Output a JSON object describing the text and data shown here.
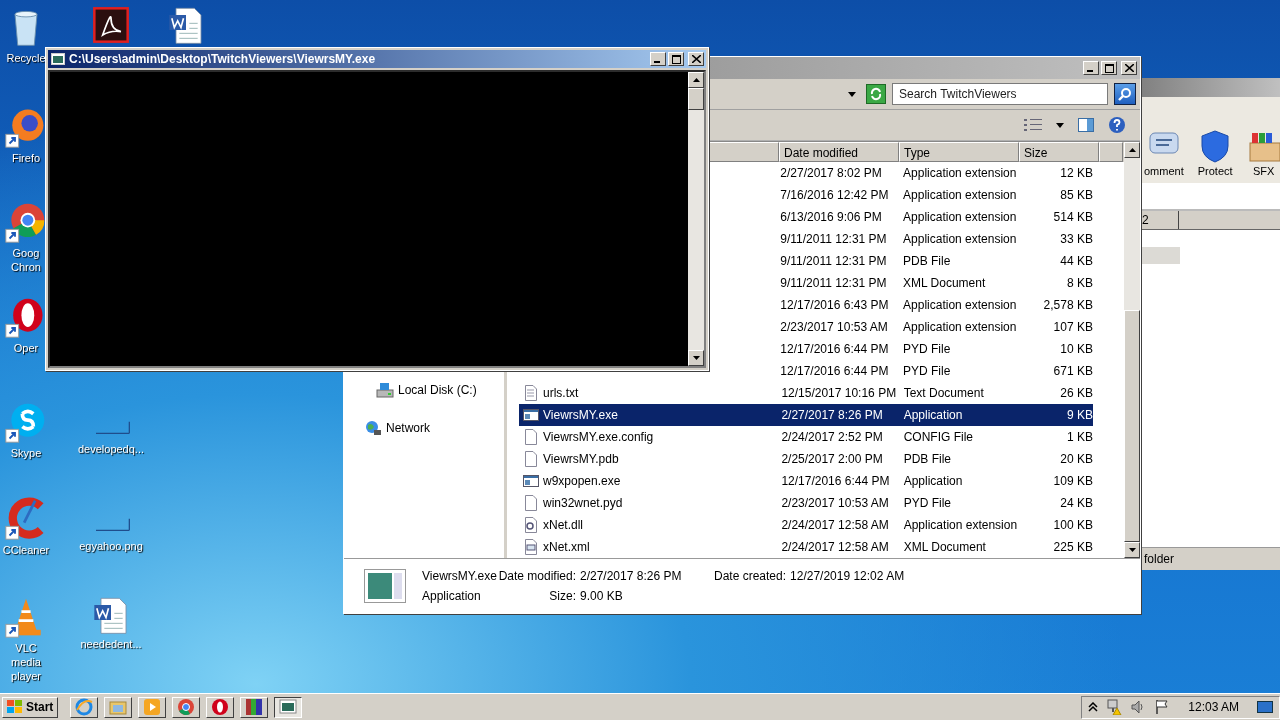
{
  "desktop": {
    "icons": [
      {
        "label": "Recycle",
        "kind": "recycle"
      },
      {
        "label": "Firefo",
        "kind": "firefox"
      },
      {
        "label": "Goog Chron",
        "kind": "chrome"
      },
      {
        "label": "Oper",
        "kind": "opera"
      },
      {
        "label": "Skype",
        "kind": "skype"
      },
      {
        "label": "CCleaner",
        "kind": "ccleaner"
      },
      {
        "label": "VLC media player",
        "kind": "vlc"
      },
      {
        "kind": "acrobat"
      },
      {
        "kind": "word"
      },
      {
        "label": "developedq...",
        "kind": "blank"
      },
      {
        "label": "egyahoo.png",
        "kind": "blank"
      },
      {
        "label": "neededent...",
        "kind": "word"
      }
    ]
  },
  "background_window": {
    "toolbar": [
      {
        "label": "omment",
        "kind": "comment"
      },
      {
        "label": "Protect",
        "kind": "protect"
      },
      {
        "label": "SFX",
        "kind": "sfx"
      }
    ],
    "column_1": "2",
    "status_text": "folder"
  },
  "explorer": {
    "search": {
      "placeholder": "Search TwitchViewers"
    },
    "columns": [
      "Date modified",
      "Type",
      "Size"
    ],
    "navigation": [
      {
        "label": "Local Disk (C:)",
        "kind": "disk"
      },
      {
        "label": "Network",
        "kind": "network"
      }
    ],
    "files": [
      {
        "date": "2/27/2017 8:02 PM",
        "type": "Application extension",
        "size": "12 KB",
        "selected": false
      },
      {
        "date": "7/16/2016 12:42 PM",
        "type": "Application extension",
        "size": "85 KB",
        "selected": false
      },
      {
        "date": "6/13/2016 9:06 PM",
        "type": "Application extension",
        "size": "514 KB",
        "selected": false
      },
      {
        "date": "9/11/2011 12:31 PM",
        "type": "Application extension",
        "size": "33 KB",
        "selected": false
      },
      {
        "date": "9/11/2011 12:31 PM",
        "type": "PDB File",
        "size": "44 KB",
        "selected": false
      },
      {
        "date": "9/11/2011 12:31 PM",
        "type": "XML Document",
        "size": "8 KB",
        "selected": false
      },
      {
        "date": "12/17/2016 6:43 PM",
        "type": "Application extension",
        "size": "2,578 KB",
        "selected": false
      },
      {
        "date": "2/23/2017 10:53 AM",
        "type": "Application extension",
        "size": "107 KB",
        "selected": false
      },
      {
        "date": "12/17/2016 6:44 PM",
        "type": "PYD File",
        "size": "10 KB",
        "selected": false
      },
      {
        "date": "12/17/2016 6:44 PM",
        "type": "PYD File",
        "size": "671 KB",
        "selected": false
      },
      {
        "name": "urls.txt",
        "kind": "text",
        "date": "12/15/2017 10:16 PM",
        "type": "Text Document",
        "size": "26 KB",
        "selected": false
      },
      {
        "name": "ViewrsMY.exe",
        "kind": "exe",
        "date": "2/27/2017 8:26 PM",
        "type": "Application",
        "size": "9 KB",
        "selected": true
      },
      {
        "name": "ViewrsMY.exe.config",
        "kind": "blank",
        "date": "2/24/2017 2:52 PM",
        "type": "CONFIG File",
        "size": "1 KB",
        "selected": false
      },
      {
        "name": "ViewrsMY.pdb",
        "kind": "blank",
        "date": "2/25/2017 2:00 PM",
        "type": "PDB File",
        "size": "20 KB",
        "selected": false
      },
      {
        "name": "w9xpopen.exe",
        "kind": "exe",
        "date": "12/17/2016 6:44 PM",
        "type": "Application",
        "size": "109 KB",
        "selected": false
      },
      {
        "name": "win32wnet.pyd",
        "kind": "blank",
        "date": "2/23/2017 10:53 AM",
        "type": "PYD File",
        "size": "24 KB",
        "selected": false
      },
      {
        "name": "xNet.dll",
        "kind": "dll",
        "date": "2/24/2017 12:58 AM",
        "type": "Application extension",
        "size": "100 KB",
        "selected": false
      },
      {
        "name": "xNet.xml",
        "kind": "xml",
        "date": "2/24/2017 12:58 AM",
        "type": "XML Document",
        "size": "225 KB",
        "selected": false
      }
    ],
    "details": {
      "name": "ViewrsMY.exe",
      "type": "Application",
      "modified_label": "Date modified:",
      "modified": "2/27/2017 8:26 PM",
      "created_label": "Date created:",
      "created": "12/27/2019 12:02 AM",
      "size_label": "Size:",
      "size": "9.00 KB"
    }
  },
  "console": {
    "title": "C:\\Users\\admin\\Desktop\\TwitchViewers\\ViewrsMY.exe"
  },
  "taskbar": {
    "start": "Start",
    "apps": [
      {
        "kind": "ie",
        "selected": false
      },
      {
        "kind": "folder",
        "selected": false
      },
      {
        "kind": "media",
        "selected": false
      },
      {
        "kind": "chrome",
        "selected": false
      },
      {
        "kind": "opera",
        "selected": false
      },
      {
        "kind": "winrar",
        "selected": false
      },
      {
        "kind": "console",
        "selected": true
      }
    ],
    "clock": "12:03 AM"
  }
}
